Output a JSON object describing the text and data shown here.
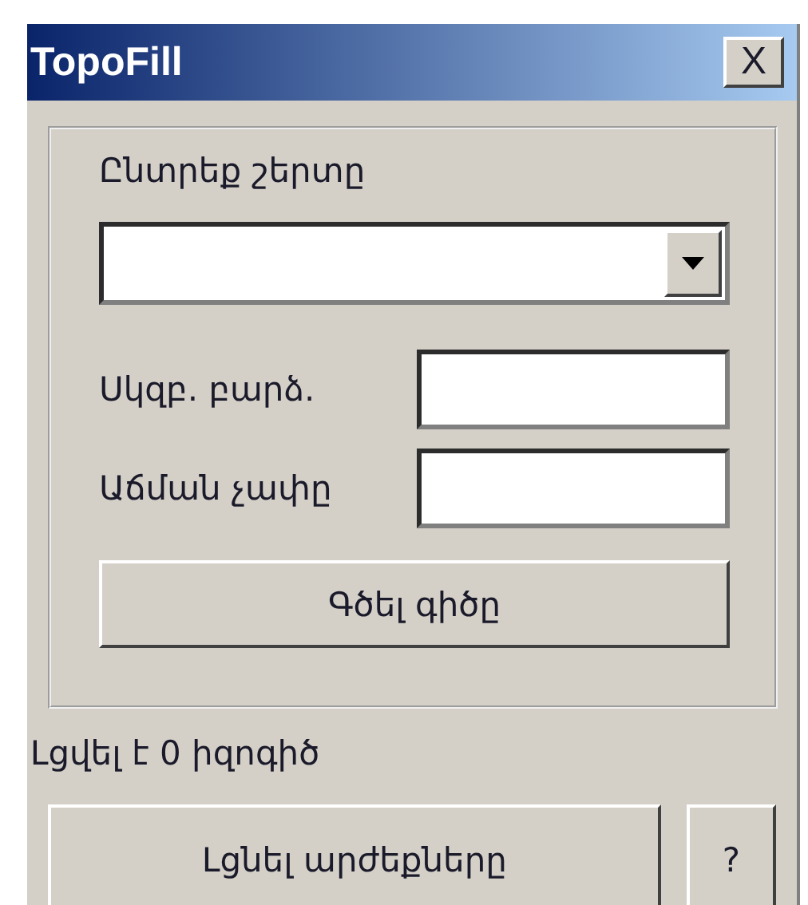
{
  "window": {
    "title": "TopoFill",
    "close": "X"
  },
  "group": {
    "layer_label": "Ընտրեք շերտը",
    "fields": [
      {
        "label": "Սկզբ. բարձ."
      },
      {
        "label": "Աճման չափը"
      }
    ],
    "draw_button": "Գծել գիծը"
  },
  "status": "Լցվել է 0 իզոգիծ",
  "buttons": [
    {
      "label": "Լցնել արժեքները",
      "kind": "wide"
    },
    {
      "label": "?",
      "kind": "small"
    }
  ]
}
